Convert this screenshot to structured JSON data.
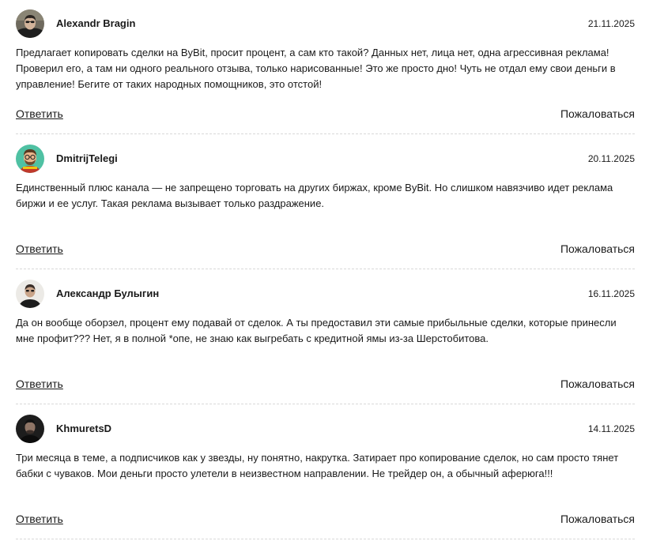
{
  "comments": [
    {
      "author": "Alexandr Bragin",
      "date": "21.11.2025",
      "text": "Предлагает копировать сделки на ByBit, просит процент, а сам кто такой? Данных нет, лица нет, одна агрессивная реклама! Проверил его, а там ни одного реального отзыва, только нарисованные! Это же просто дно! Чуть не отдал ему свои деньги в управление! Бегите от таких народных помощников, это отстой!",
      "reply_label": "Ответить",
      "report_label": "Пожаловаться",
      "avatar_icon": "user-photo-icon"
    },
    {
      "author": "DmitrijTelegi",
      "date": "20.11.2025",
      "text": "Единственный плюс канала — не запрещено торговать на других биржах, кроме ByBit. Но слишком навязчиво идет реклама биржи и ее услуг. Такая реклама вызывает только раздражение.",
      "reply_label": "Ответить",
      "report_label": "Пожаловаться",
      "avatar_icon": "cartoon-avatar-icon"
    },
    {
      "author": "Александр Булыгин",
      "date": "16.11.2025",
      "text": "Да он вообще оборзел, процент ему подавай от сделок. А ты предоставил эти самые прибыльные сделки, которые принесли мне профит??? Нет, я в полной *опе, не знаю как выгребать с кредитной ямы из-за Шерстобитова.",
      "reply_label": "Ответить",
      "report_label": "Пожаловаться",
      "avatar_icon": "user-photo-icon"
    },
    {
      "author": "KhmuretsD",
      "date": "14.11.2025",
      "text": "Три месяца в теме, а подписчиков как у звезды, ну понятно, накрутка. Затирает про копирование сделок, но сам просто тянет бабки с чуваков. Мои деньги просто улетели в неизвестном направлении. Не трейдер он, а обычный аферюга!!!",
      "reply_label": "Ответить",
      "report_label": "Пожаловаться",
      "avatar_icon": "user-photo-icon"
    }
  ]
}
